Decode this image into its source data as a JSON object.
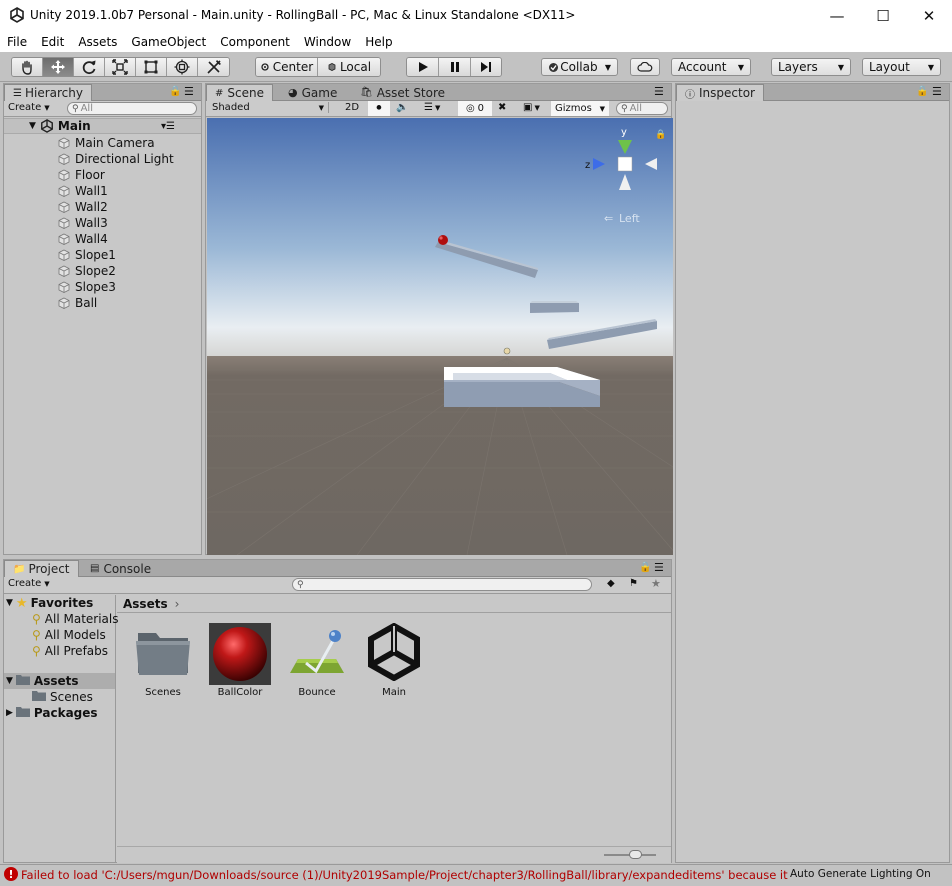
{
  "window": {
    "title": "Unity 2019.1.0b7 Personal - Main.unity - RollingBall - PC, Mac & Linux Standalone <DX11>"
  },
  "menu": [
    "File",
    "Edit",
    "Assets",
    "GameObject",
    "Component",
    "Window",
    "Help"
  ],
  "toolbar": {
    "tools": [
      "hand-tool-icon",
      "move-tool-icon",
      "rotate-tool-icon",
      "scale-tool-icon",
      "rect-tool-icon",
      "transform-tool-icon",
      "custom-tool-icon"
    ],
    "pivot_label": "Center",
    "space_label": "Local",
    "collab_label": "Collab",
    "account_label": "Account",
    "layers_label": "Layers",
    "layout_label": "Layout"
  },
  "hierarchy": {
    "tab_label": "Hierarchy",
    "create_label": "Create",
    "search_placeholder": "All",
    "scene_name": "Main",
    "items": [
      "Main Camera",
      "Directional Light",
      "Floor",
      "Wall1",
      "Wall2",
      "Wall3",
      "Wall4",
      "Slope1",
      "Slope2",
      "Slope3",
      "Ball"
    ]
  },
  "scene": {
    "tabs": [
      "Scene",
      "Game",
      "Asset Store"
    ],
    "shading_mode": "Shaded",
    "mode_2d": "2D",
    "hidden_count": "0",
    "gizmos_label": "Gizmos",
    "search_placeholder": "All",
    "gizmo_axes": {
      "y": "y",
      "z": "z"
    },
    "view_label": "Left"
  },
  "inspector": {
    "tab_label": "Inspector"
  },
  "project": {
    "tabs": [
      "Project",
      "Console"
    ],
    "create_label": "Create",
    "favorites_label": "Favorites",
    "favorites": [
      "All Materials",
      "All Models",
      "All Prefabs"
    ],
    "assets_label": "Assets",
    "assets_children": [
      "Scenes"
    ],
    "packages_label": "Packages",
    "breadcrumb": "Assets",
    "assets": [
      {
        "name": "Scenes",
        "icon": "folder-icon"
      },
      {
        "name": "BallColor",
        "icon": "material-sphere-icon"
      },
      {
        "name": "Bounce",
        "icon": "physics-material-icon"
      },
      {
        "name": "Main",
        "icon": "unity-scene-icon"
      }
    ]
  },
  "status": {
    "error_text": "Failed to load 'C:/Users/mgun/Downloads/source (1)/Unity2019Sample/Project/chapter3/RollingBall/library/expandeditems' because it",
    "lighting_text": "Auto Generate Lighting On"
  },
  "colors": {
    "error": "#c00000",
    "sky_top": "#4a6fb0",
    "horizon": "#e9eef2",
    "ground": "#6e6862"
  }
}
